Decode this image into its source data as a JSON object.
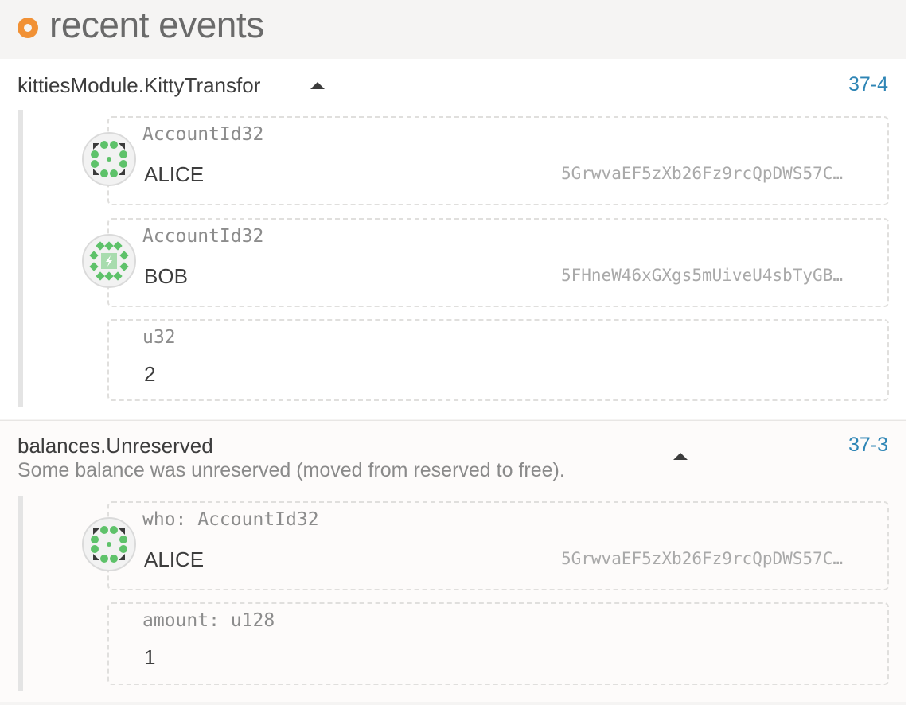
{
  "header": {
    "title": "recent events",
    "accent_color": "#f19135"
  },
  "events": [
    {
      "name": "kittiesModule.KittyTransfor",
      "description": "",
      "id": "37-4",
      "params": [
        {
          "label": "AccountId32",
          "name": "ALICE",
          "address": "5GrwvaEF5zXb26Fz9rcQpDWS57C…",
          "icon": "alice-identicon"
        },
        {
          "label": "AccountId32",
          "name": "BOB",
          "address": "5FHneW46xGXgs5mUiveU4sbTyGB…",
          "icon": "bob-identicon"
        },
        {
          "label": "u32",
          "value": "2"
        }
      ]
    },
    {
      "name": "balances.Unreserved",
      "description": "Some balance was unreserved (moved from reserved to free).",
      "id": "37-3",
      "params": [
        {
          "label": "who: AccountId32",
          "name": "ALICE",
          "address": "5GrwvaEF5zXb26Fz9rcQpDWS57C…",
          "icon": "alice-identicon"
        },
        {
          "label": "amount: u128",
          "value": "1"
        }
      ]
    }
  ],
  "colors": {
    "link": "#2e85b5",
    "identicon_green": "#5ec26a",
    "identicon_dark": "#3a3a3a"
  }
}
